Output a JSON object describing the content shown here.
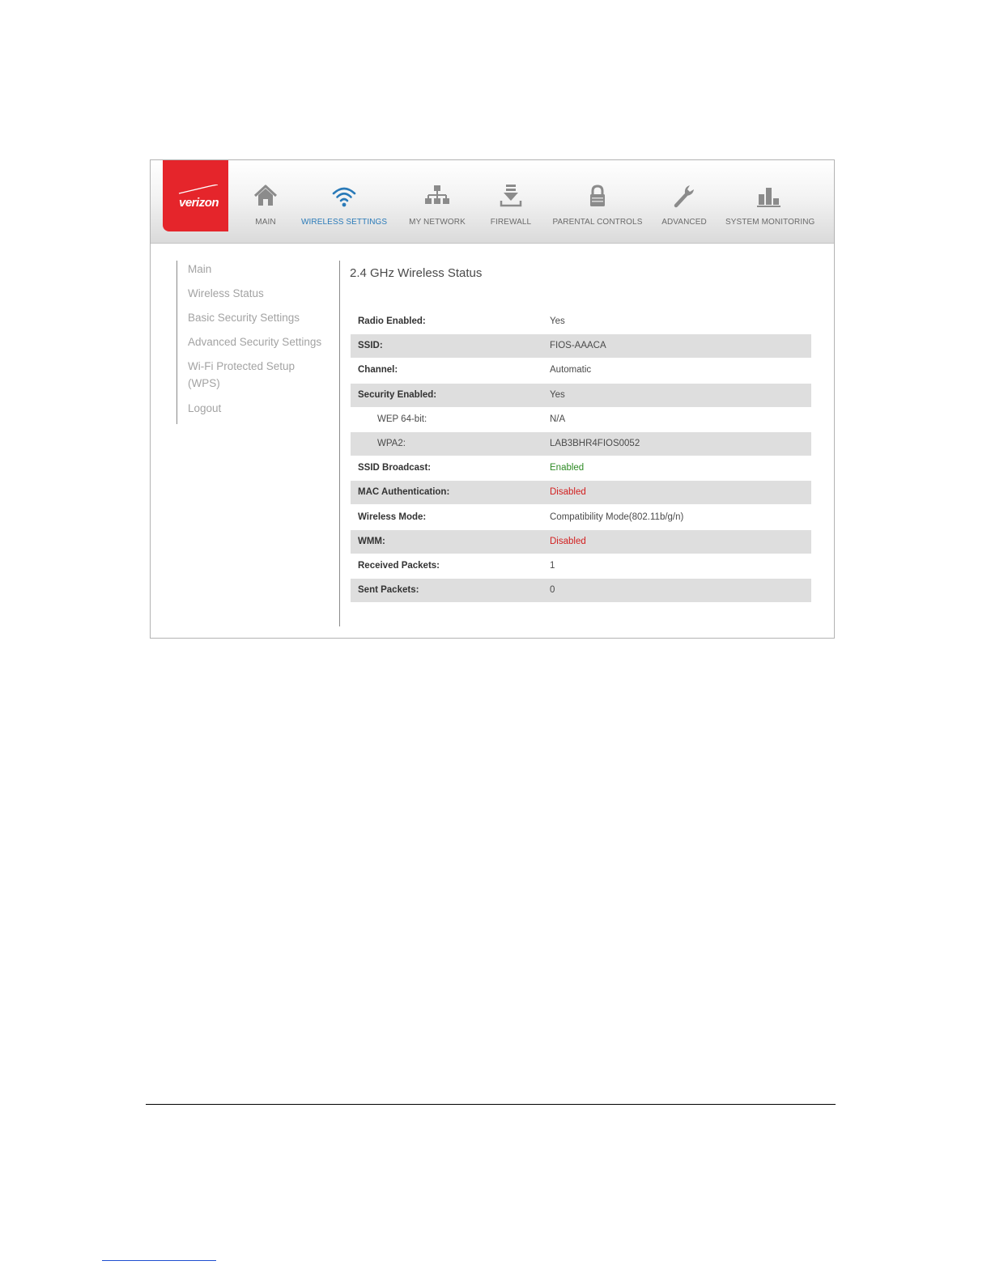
{
  "brand": {
    "logo_text": "verizon",
    "accent": "#e5252b",
    "active_color": "#2a7ab8"
  },
  "nav": [
    {
      "label": "MAIN",
      "icon": "home-icon"
    },
    {
      "label": "WIRELESS SETTINGS",
      "icon": "wifi-icon",
      "active": true
    },
    {
      "label": "MY NETWORK",
      "icon": "network-icon"
    },
    {
      "label": "FIREWALL",
      "icon": "firewall-icon"
    },
    {
      "label": "PARENTAL CONTROLS",
      "icon": "lock-icon"
    },
    {
      "label": "ADVANCED",
      "icon": "wrench-icon"
    },
    {
      "label": "SYSTEM MONITORING",
      "icon": "bar-chart-icon"
    }
  ],
  "sidebar": {
    "items": [
      {
        "label": "Main"
      },
      {
        "label": "Wireless Status"
      },
      {
        "label": "Basic Security Settings"
      },
      {
        "label": "Advanced Security Settings"
      },
      {
        "label": "Wi-Fi Protected Setup (WPS)"
      },
      {
        "label": "Logout"
      }
    ]
  },
  "content": {
    "title": "2.4 GHz Wireless Status",
    "rows": [
      {
        "label": "Radio Enabled:",
        "value": "Yes"
      },
      {
        "label": "SSID:",
        "value": "FIOS-AAACA"
      },
      {
        "label": "Channel:",
        "value": "Automatic"
      },
      {
        "label": "Security Enabled:",
        "value": "Yes"
      },
      {
        "label": "WEP 64-bit:",
        "value": "N/A"
      },
      {
        "label": "WPA2:",
        "value": "LAB3BHR4FIOS0052"
      },
      {
        "label": "SSID Broadcast:",
        "value": "Enabled"
      },
      {
        "label": "MAC Authentication:",
        "value": "Disabled"
      },
      {
        "label": "Wireless Mode:",
        "value": "Compatibility Mode(802.11b/g/n)"
      },
      {
        "label": "WMM:",
        "value": "Disabled"
      },
      {
        "label": "Received Packets:",
        "value": "1"
      },
      {
        "label": "Sent Packets:",
        "value": "0"
      }
    ]
  },
  "colors": {
    "enabled": "#2e8b25",
    "disabled": "#d21f1f",
    "row_shade": "#dedede"
  }
}
